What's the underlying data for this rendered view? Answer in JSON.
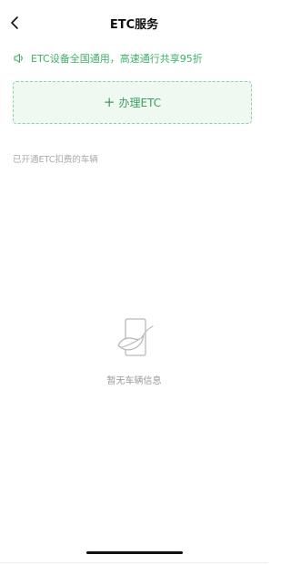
{
  "header": {
    "title": "ETC服务",
    "back_icon": "chevron-left-icon"
  },
  "notice": {
    "icon": "speaker-icon",
    "text": "ETC设备全国通用，高速通行共享95折",
    "color": "#3fae6a"
  },
  "apply": {
    "plus": "+",
    "label": "办理ETC",
    "accent": "#3a9f60",
    "background": "#f0f8f2",
    "border": "#8fd1a5"
  },
  "vehicles": {
    "section_label": "已开通ETC扣费的车辆",
    "empty_icon": "empty-document-leaf-icon",
    "empty_text": "暂无车辆信息"
  }
}
